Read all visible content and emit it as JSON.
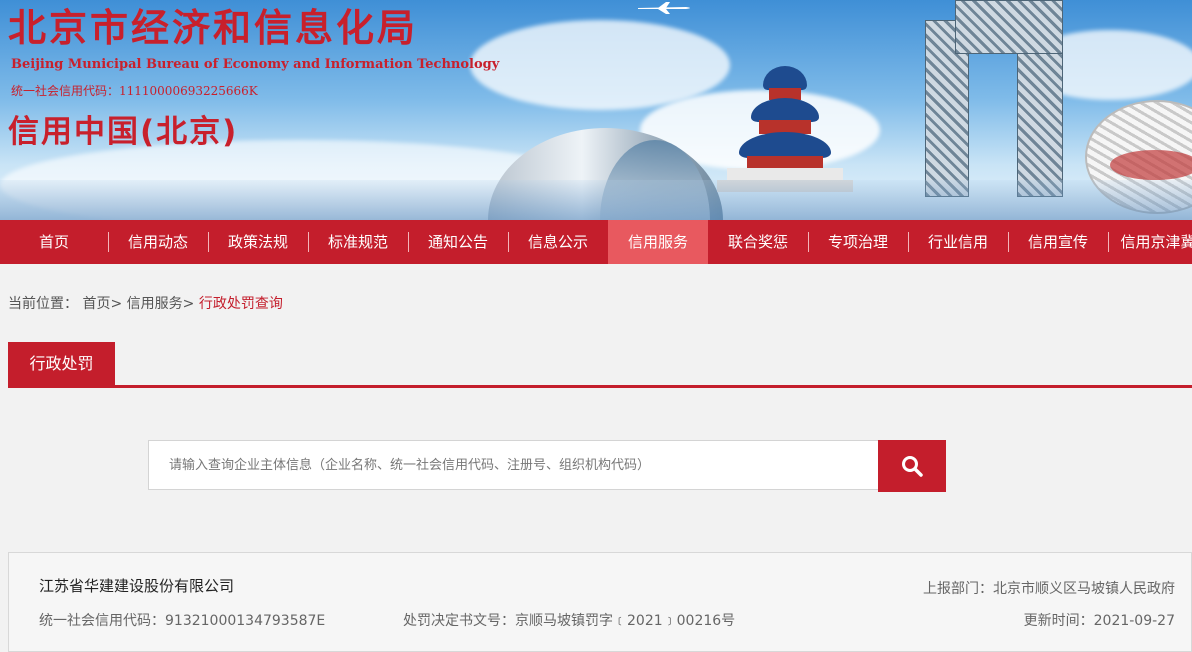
{
  "header": {
    "title_cn": "北京市经济和信息化局",
    "title_en": "Beijing Municipal Bureau of Economy and Information Technology",
    "credit_code": "统一社会信用代码：11110000693225666K",
    "site_name": "信用中国(北京)"
  },
  "nav": {
    "items": [
      "首页",
      "信用动态",
      "政策法规",
      "标准规范",
      "通知公告",
      "信息公示",
      "信用服务",
      "联合奖惩",
      "专项治理",
      "行业信用",
      "信用宣传",
      "信用京津冀"
    ],
    "active": "信用服务"
  },
  "breadcrumb": {
    "prefix": "当前位置：",
    "home": "首页",
    "sep": ">",
    "section": "信用服务",
    "current": "行政处罚查询"
  },
  "section_tab": "行政处罚",
  "search": {
    "placeholder": "请输入查询企业主体信息（企业名称、统一社会信用代码、注册号、组织机构代码）",
    "button_icon": "search-icon"
  },
  "result": {
    "company": "江苏省华建建设股份有限公司",
    "credit_code": "统一社会信用代码：91321000134793587E",
    "decision_no": "处罚决定书文号：京顺马坡镇罚字﹝2021﹞00216号",
    "report_dept": "上报部门：北京市顺义区马坡镇人民政府",
    "update_time": "更新时间：2021-09-27"
  },
  "colors": {
    "brand_red": "#c41e2c",
    "active_tab": "#e8595f"
  }
}
